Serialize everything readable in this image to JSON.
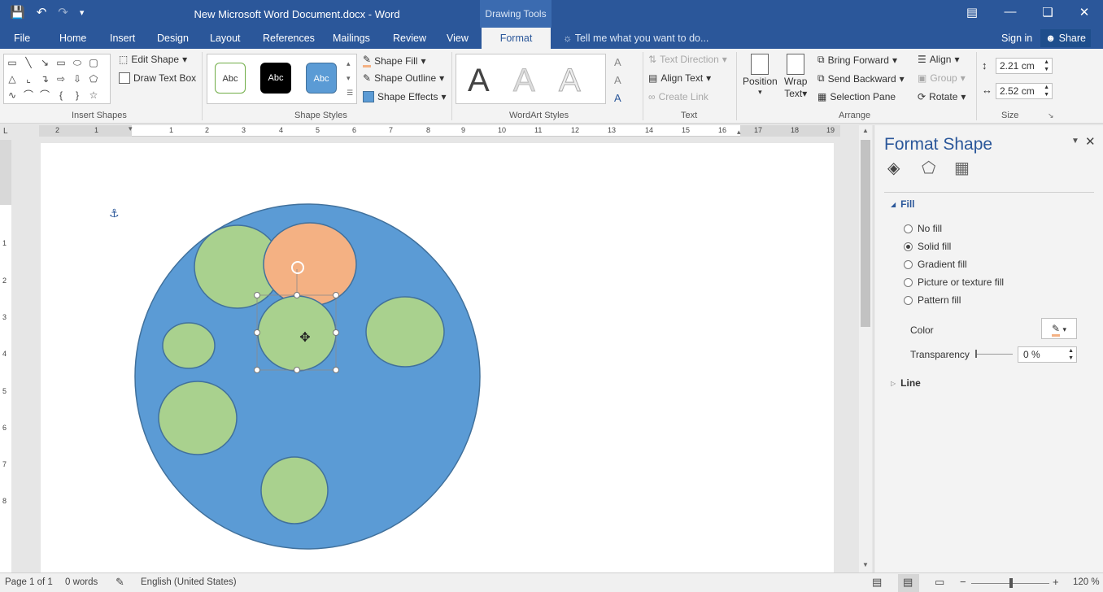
{
  "titlebar": {
    "document_title": "New Microsoft Word Document.docx - Word",
    "contextual_tab": "Drawing Tools",
    "qat_icons": [
      "save-icon",
      "undo-icon",
      "redo-icon",
      "customize-icon"
    ]
  },
  "tabs": {
    "file": "File",
    "home": "Home",
    "insert": "Insert",
    "design": "Design",
    "layout": "Layout",
    "references": "References",
    "mailings": "Mailings",
    "review": "Review",
    "view": "View",
    "format": "Format",
    "tell_me": "Tell me what you want to do...",
    "sign_in": "Sign in",
    "share": "Share"
  },
  "ribbon": {
    "insert_shapes": {
      "label": "Insert Shapes",
      "edit_shape": "Edit Shape",
      "draw_text_box": "Draw Text Box"
    },
    "shape_styles": {
      "label": "Shape Styles",
      "swatch_text": "Abc",
      "shape_fill": "Shape Fill",
      "shape_outline": "Shape Outline",
      "shape_effects": "Shape Effects"
    },
    "wordart": {
      "label": "WordArt Styles",
      "letter": "A"
    },
    "text": {
      "label": "Text",
      "text_direction": "Text Direction",
      "align_text": "Align Text",
      "create_link": "Create Link"
    },
    "arrange": {
      "label": "Arrange",
      "position": "Position",
      "wrap_text": "Wrap",
      "wrap_text2": "Text",
      "bring_forward": "Bring Forward",
      "send_backward": "Send Backward",
      "selection_pane": "Selection Pane",
      "align": "Align",
      "group": "Group",
      "rotate": "Rotate"
    },
    "size": {
      "label": "Size",
      "height": "2.21 cm",
      "width": "2.52 cm"
    }
  },
  "ruler": {
    "h_numbers": [
      "2",
      "1",
      "1",
      "2",
      "3",
      "4",
      "5",
      "6",
      "7",
      "8",
      "9",
      "10",
      "11",
      "12",
      "13",
      "14",
      "15",
      "16",
      "17",
      "18",
      "19"
    ],
    "v_numbers": [
      "1",
      "2",
      "3",
      "4",
      "5",
      "6",
      "7",
      "8"
    ]
  },
  "pane": {
    "title": "Format Shape",
    "fill_section": "Fill",
    "no_fill": "No fill",
    "solid_fill": "Solid fill",
    "gradient_fill": "Gradient fill",
    "picture_fill": "Picture or texture fill",
    "pattern_fill": "Pattern fill",
    "color_label": "Color",
    "transparency_label": "Transparency",
    "transparency_value": "0 %",
    "line_section": "Line",
    "selected_fill": "solid_fill"
  },
  "statusbar": {
    "page": "Page 1 of 1",
    "words": "0 words",
    "language": "English (United States)",
    "zoom": "120 %"
  },
  "colors": {
    "accent": "#2b579a",
    "big_circle": "#5b9bd5",
    "small_circle": "#a9d18e",
    "orange_circle": "#f4b183",
    "outline": "#41719c"
  }
}
